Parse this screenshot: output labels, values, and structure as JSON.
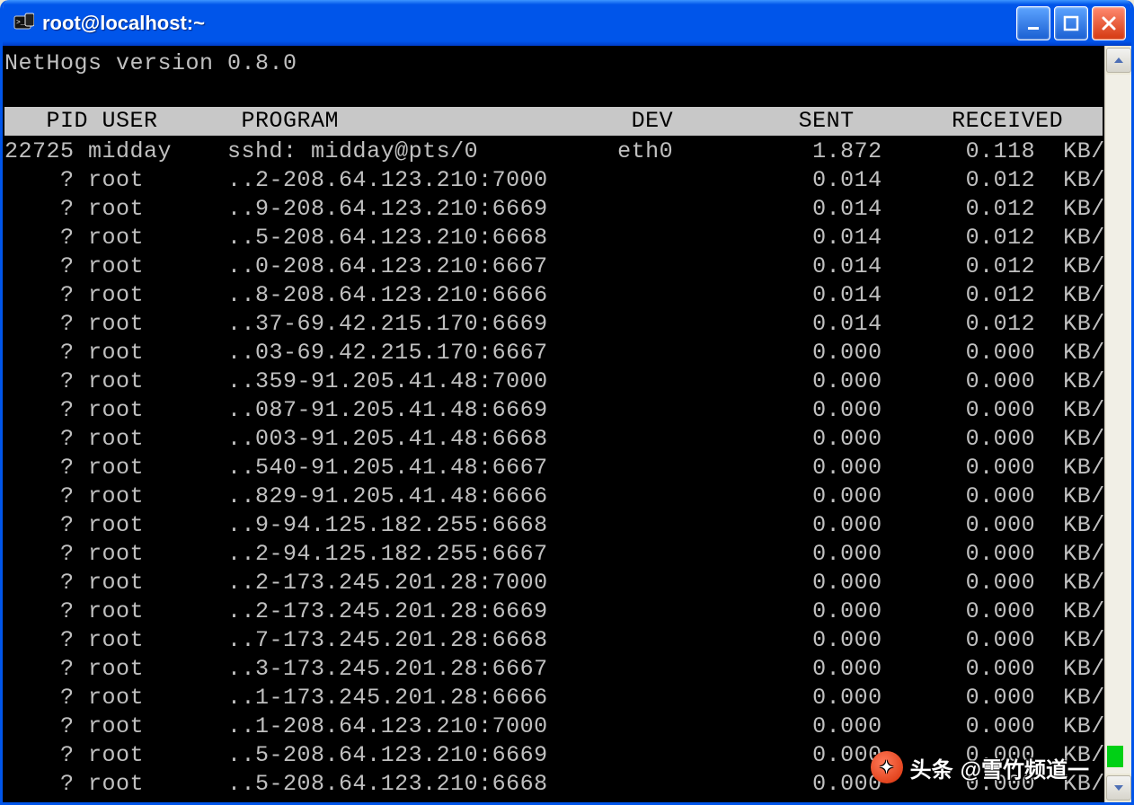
{
  "window": {
    "title": "root@localhost:~"
  },
  "terminal": {
    "version_line": "NetHogs version 0.8.0",
    "columns": {
      "pid": "PID",
      "user": "USER",
      "program": "PROGRAM",
      "dev": "DEV",
      "sent": "SENT",
      "received": "RECEIVED"
    },
    "rows": [
      {
        "pid": "22725",
        "user": "midday",
        "program": "sshd: midday@pts/0",
        "dev": "eth0",
        "sent": "1.872",
        "received": "0.118",
        "unit": "KB/sec"
      },
      {
        "pid": "?",
        "user": "root",
        "program": "..2-208.64.123.210:7000",
        "dev": "",
        "sent": "0.014",
        "received": "0.012",
        "unit": "KB/sec"
      },
      {
        "pid": "?",
        "user": "root",
        "program": "..9-208.64.123.210:6669",
        "dev": "",
        "sent": "0.014",
        "received": "0.012",
        "unit": "KB/sec"
      },
      {
        "pid": "?",
        "user": "root",
        "program": "..5-208.64.123.210:6668",
        "dev": "",
        "sent": "0.014",
        "received": "0.012",
        "unit": "KB/sec"
      },
      {
        "pid": "?",
        "user": "root",
        "program": "..0-208.64.123.210:6667",
        "dev": "",
        "sent": "0.014",
        "received": "0.012",
        "unit": "KB/sec"
      },
      {
        "pid": "?",
        "user": "root",
        "program": "..8-208.64.123.210:6666",
        "dev": "",
        "sent": "0.014",
        "received": "0.012",
        "unit": "KB/sec"
      },
      {
        "pid": "?",
        "user": "root",
        "program": "..37-69.42.215.170:6669",
        "dev": "",
        "sent": "0.014",
        "received": "0.012",
        "unit": "KB/sec"
      },
      {
        "pid": "?",
        "user": "root",
        "program": "..03-69.42.215.170:6667",
        "dev": "",
        "sent": "0.000",
        "received": "0.000",
        "unit": "KB/sec"
      },
      {
        "pid": "?",
        "user": "root",
        "program": "..359-91.205.41.48:7000",
        "dev": "",
        "sent": "0.000",
        "received": "0.000",
        "unit": "KB/sec"
      },
      {
        "pid": "?",
        "user": "root",
        "program": "..087-91.205.41.48:6669",
        "dev": "",
        "sent": "0.000",
        "received": "0.000",
        "unit": "KB/sec"
      },
      {
        "pid": "?",
        "user": "root",
        "program": "..003-91.205.41.48:6668",
        "dev": "",
        "sent": "0.000",
        "received": "0.000",
        "unit": "KB/sec"
      },
      {
        "pid": "?",
        "user": "root",
        "program": "..540-91.205.41.48:6667",
        "dev": "",
        "sent": "0.000",
        "received": "0.000",
        "unit": "KB/sec"
      },
      {
        "pid": "?",
        "user": "root",
        "program": "..829-91.205.41.48:6666",
        "dev": "",
        "sent": "0.000",
        "received": "0.000",
        "unit": "KB/sec"
      },
      {
        "pid": "?",
        "user": "root",
        "program": "..9-94.125.182.255:6668",
        "dev": "",
        "sent": "0.000",
        "received": "0.000",
        "unit": "KB/sec"
      },
      {
        "pid": "?",
        "user": "root",
        "program": "..2-94.125.182.255:6667",
        "dev": "",
        "sent": "0.000",
        "received": "0.000",
        "unit": "KB/sec"
      },
      {
        "pid": "?",
        "user": "root",
        "program": "..2-173.245.201.28:7000",
        "dev": "",
        "sent": "0.000",
        "received": "0.000",
        "unit": "KB/sec"
      },
      {
        "pid": "?",
        "user": "root",
        "program": "..2-173.245.201.28:6669",
        "dev": "",
        "sent": "0.000",
        "received": "0.000",
        "unit": "KB/sec"
      },
      {
        "pid": "?",
        "user": "root",
        "program": "..7-173.245.201.28:6668",
        "dev": "",
        "sent": "0.000",
        "received": "0.000",
        "unit": "KB/sec"
      },
      {
        "pid": "?",
        "user": "root",
        "program": "..3-173.245.201.28:6667",
        "dev": "",
        "sent": "0.000",
        "received": "0.000",
        "unit": "KB/sec"
      },
      {
        "pid": "?",
        "user": "root",
        "program": "..1-173.245.201.28:6666",
        "dev": "",
        "sent": "0.000",
        "received": "0.000",
        "unit": "KB/sec"
      },
      {
        "pid": "?",
        "user": "root",
        "program": "..1-208.64.123.210:7000",
        "dev": "",
        "sent": "0.000",
        "received": "0.000",
        "unit": "KB/sec"
      },
      {
        "pid": "?",
        "user": "root",
        "program": "..5-208.64.123.210:6669",
        "dev": "",
        "sent": "0.000",
        "received": "0.000",
        "unit": "KB/sec"
      },
      {
        "pid": "?",
        "user": "root",
        "program": "..5-208.64.123.210:6668",
        "dev": "",
        "sent": "0.000",
        "received": "0.000",
        "unit": "KB/sec"
      }
    ]
  },
  "watermark": {
    "prefix": "头条",
    "text": "@雪竹频道一"
  }
}
